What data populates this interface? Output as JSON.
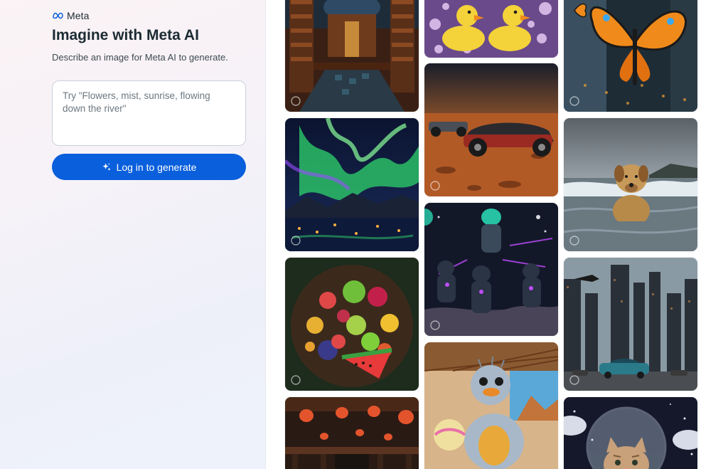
{
  "brand": {
    "name": "Meta",
    "logo_icon": "meta-infinity-logo"
  },
  "header": {
    "title": "Imagine with Meta AI",
    "subtitle": "Describe an image for Meta AI to generate."
  },
  "prompt": {
    "placeholder": "Try \"Flowers, mist, sunrise, flowing down the river\"",
    "value": ""
  },
  "login_button": {
    "label": "Log in to generate",
    "icon": "sparkle-icon",
    "color": "#0a5fdc"
  },
  "gallery": {
    "columns": [
      [
        {
          "subject": "library",
          "icon": "meta-ai-badge-icon"
        },
        {
          "subject": "aurora",
          "icon": "meta-ai-badge-icon"
        },
        {
          "subject": "fruit-platter",
          "icon": "meta-ai-badge-icon"
        },
        {
          "subject": "lantern-hall",
          "icon": "meta-ai-badge-icon"
        }
      ],
      [
        {
          "subject": "rubber-ducks",
          "icon": "meta-ai-badge-icon"
        },
        {
          "subject": "desert-race-cars",
          "icon": "meta-ai-badge-icon"
        },
        {
          "subject": "space-cats",
          "icon": "meta-ai-badge-icon"
        },
        {
          "subject": "fluffy-bird",
          "icon": "meta-ai-badge-icon"
        }
      ],
      [
        {
          "subject": "butterfly-street",
          "icon": "meta-ai-badge-icon"
        },
        {
          "subject": "dog-in-sea",
          "icon": "meta-ai-badge-icon"
        },
        {
          "subject": "futuristic-city",
          "icon": "meta-ai-badge-icon"
        },
        {
          "subject": "astronaut-kitten",
          "icon": "meta-ai-badge-icon"
        }
      ]
    ]
  }
}
